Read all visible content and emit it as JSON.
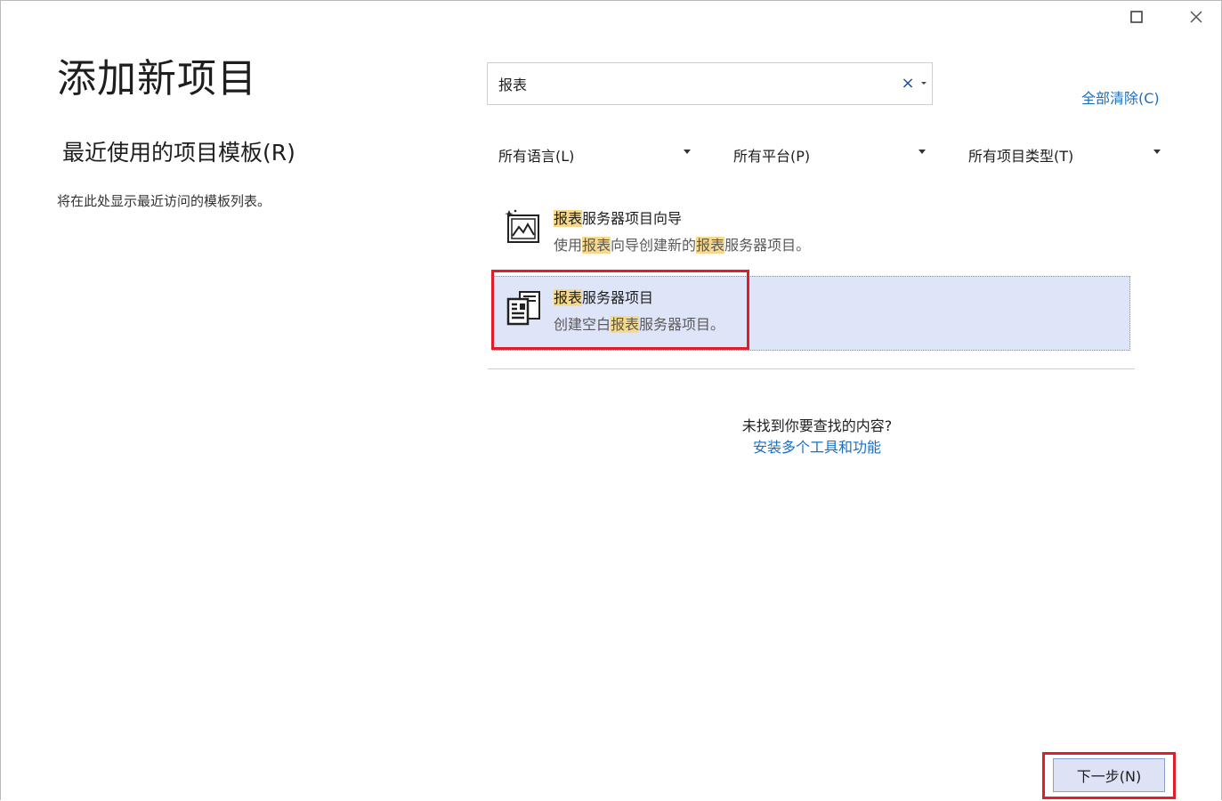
{
  "window": {
    "maximize_icon": "maximize-icon",
    "close_icon": "close-icon"
  },
  "title": "添加新项目",
  "recent": {
    "heading": "最近使用的项目模板(R)",
    "empty_text": "将在此处显示最近访问的模板列表。"
  },
  "search": {
    "value": "报表",
    "clear_icon": "clear-icon",
    "dropdown_icon": "chevron-down-icon",
    "clear_all": "全部清除(C)"
  },
  "filters": [
    {
      "label": "所有语言(L)"
    },
    {
      "label": "所有平台(P)"
    },
    {
      "label": "所有项目类型(T)"
    }
  ],
  "results": [
    {
      "icon": "report-wizard-icon",
      "name_hl": "报表",
      "name_rest": "服务器项目向导",
      "desc_1": "使用",
      "desc_hl_1": "报表",
      "desc_2": "向导创建新的",
      "desc_hl_2": "报表",
      "desc_3": "服务器项目。",
      "selected": false
    },
    {
      "icon": "report-project-icon",
      "name_hl": "报表",
      "name_rest": "服务器项目",
      "desc_1": "创建空白",
      "desc_hl_1": "报表",
      "desc_2": "服务器项目。",
      "selected": true
    }
  ],
  "not_found": {
    "question": "未找到你要查找的内容?",
    "link": "安装多个工具和功能"
  },
  "next_button": "下一步(N)",
  "colors": {
    "accent_link": "#1a6ec1",
    "highlight": "#f6d98b",
    "selected_bg": "#dfe5f8",
    "red_outline": "#e01d2a"
  }
}
